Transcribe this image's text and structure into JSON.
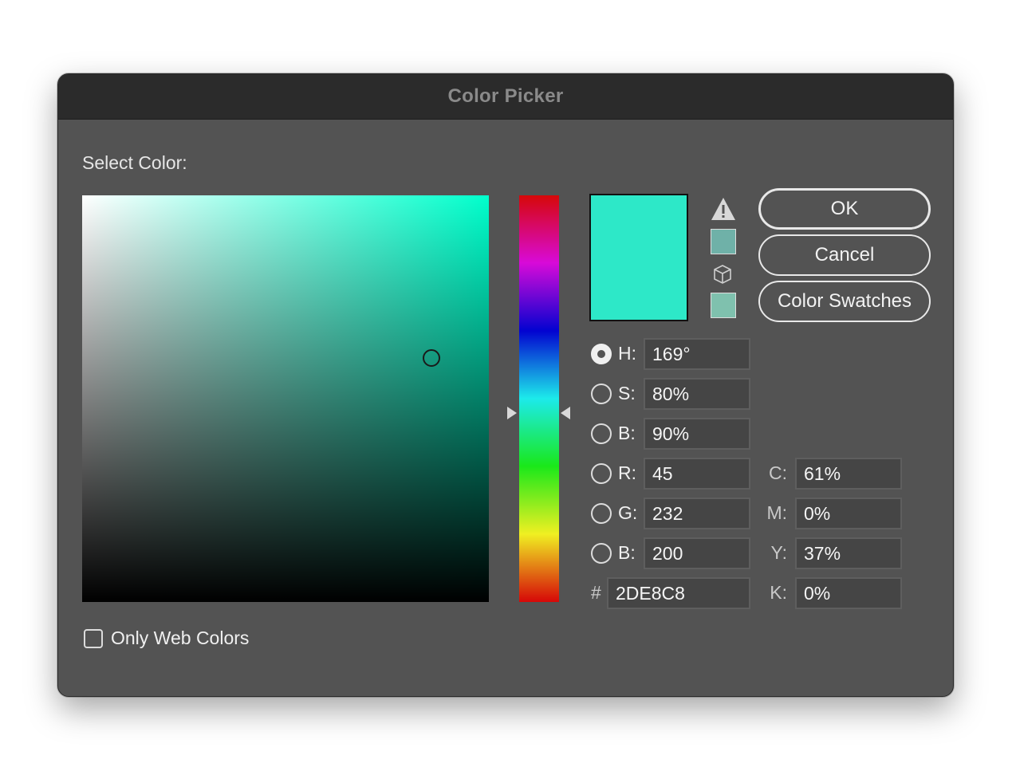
{
  "window": {
    "title": "Color Picker"
  },
  "picker": {
    "select_label": "Select Color:",
    "hue_color": "#00ffcc",
    "new_color": "#2DE8C8",
    "gamut_color": "#6fb1a8",
    "web_color": "#7fc1ae"
  },
  "buttons": {
    "ok": "OK",
    "cancel": "Cancel",
    "swatches": "Color Swatches"
  },
  "hsb": {
    "h_label": "H:",
    "h_value": "169°",
    "s_label": "S:",
    "s_value": "80%",
    "b_label": "B:",
    "b_value": "90%"
  },
  "rgb": {
    "r_label": "R:",
    "r_value": "45",
    "g_label": "G:",
    "g_value": "232",
    "b_label": "B:",
    "b_value": "200"
  },
  "hex": {
    "label": "#",
    "value": "2DE8C8"
  },
  "cmyk": {
    "c_label": "C:",
    "c_value": "61%",
    "m_label": "M:",
    "m_value": "0%",
    "y_label": "Y:",
    "y_value": "37%",
    "k_label": "K:",
    "k_value": "0%"
  },
  "options": {
    "only_web_colors": "Only Web Colors",
    "only_web_colors_checked": false
  },
  "icons": [
    "out-of-gamut-warning-icon",
    "web-safe-cube-icon"
  ]
}
